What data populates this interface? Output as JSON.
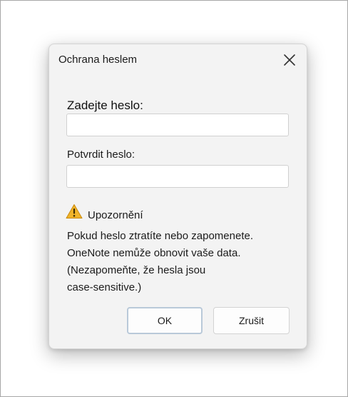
{
  "dialog": {
    "title": "Ochrana heslem",
    "close_icon": "close-icon"
  },
  "form": {
    "password_label": "Zadejte heslo:",
    "password_value": "",
    "confirm_label": "Potvrdit heslo:",
    "confirm_value": ""
  },
  "warning": {
    "icon": "warning-icon",
    "icon_color": "#e8a317",
    "title": "Upozornění",
    "lines": [
      "Pokud heslo ztratíte nebo zapomenete.",
      "OneNote nemůže obnovit vaše data.",
      "(Nezapomeňte, že hesla jsou",
      "case-sensitive.)"
    ]
  },
  "buttons": {
    "ok_label": "OK",
    "cancel_label": "Zrušit"
  }
}
